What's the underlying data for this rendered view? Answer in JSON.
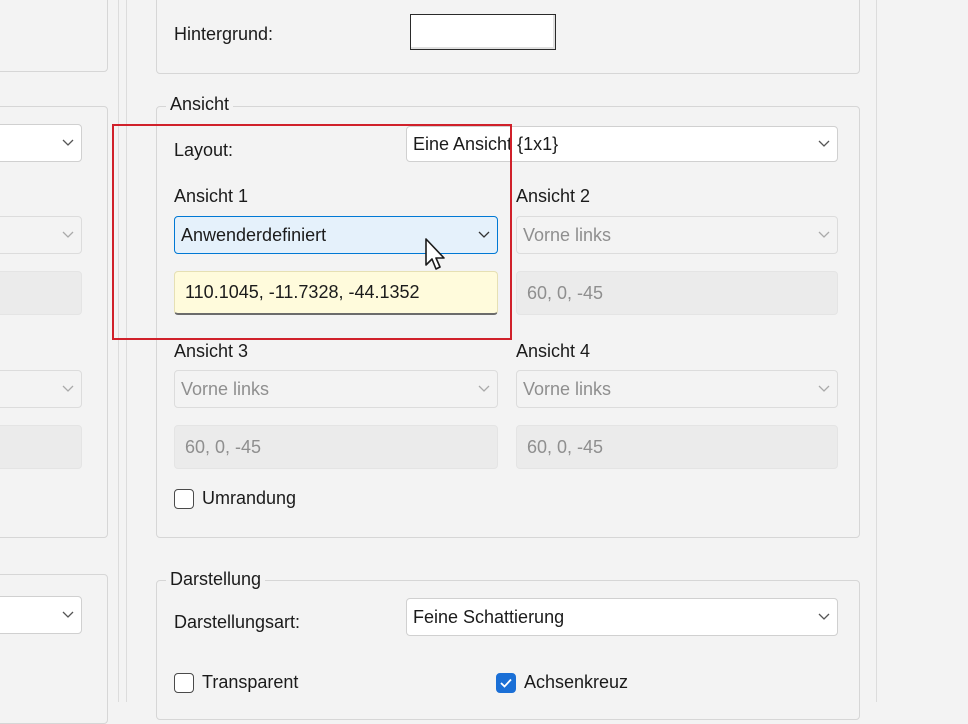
{
  "colors": {
    "accent": "#1a6fd6",
    "highlight": "#d0202a",
    "tooltip_bg": "#fffbdc"
  },
  "hintergrund": {
    "label": "Hintergrund:",
    "swatch_color": "#ffffff"
  },
  "ansicht": {
    "title": "Ansicht",
    "layout_label": "Layout:",
    "layout_value": "Eine Ansicht {1x1}",
    "view1": {
      "label": "Ansicht 1",
      "value": "Anwenderdefiniert",
      "coords": "110.1045, -11.7328, -44.1352"
    },
    "view2": {
      "label": "Ansicht 2",
      "value": "Vorne links",
      "coords": "60, 0, -45"
    },
    "view3": {
      "label": "Ansicht 3",
      "value": "Vorne links",
      "coords": "60, 0, -45"
    },
    "view4": {
      "label": "Ansicht 4",
      "value": "Vorne links",
      "coords": "60, 0, -45"
    },
    "border_checkbox": "Umrandung"
  },
  "darstellung": {
    "title": "Darstellung",
    "mode_label": "Darstellungsart:",
    "mode_value": "Feine Schattierung",
    "transparent_label": "Transparent",
    "axes_label": "Achsenkreuz"
  }
}
